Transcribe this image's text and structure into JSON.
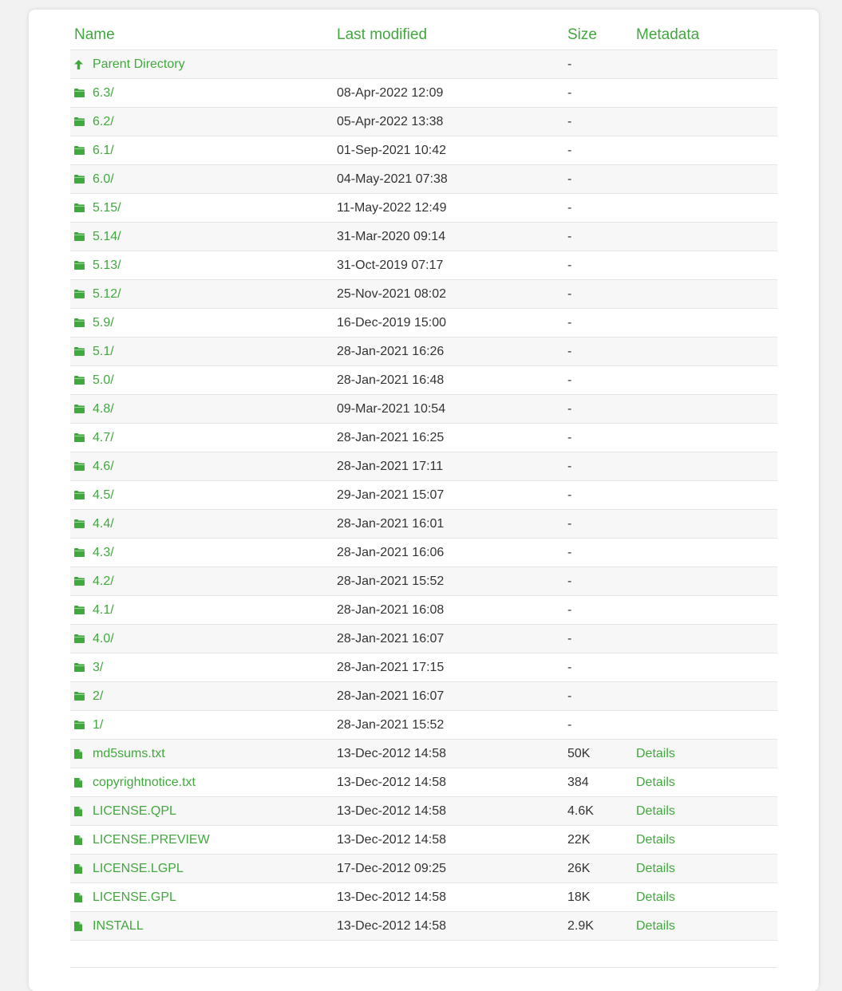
{
  "colors": {
    "accent": "#41a83e",
    "text": "#333333",
    "stripe": "#f7f7f7"
  },
  "columns": {
    "name": "Name",
    "last_modified": "Last modified",
    "size": "Size",
    "metadata": "Metadata"
  },
  "rows": [
    {
      "type": "parent",
      "icon": "arrow-up-icon",
      "name": "Parent Directory",
      "modified": "",
      "size": "-",
      "meta": ""
    },
    {
      "type": "dir",
      "icon": "folder-icon",
      "name": "6.3/",
      "modified": "08-Apr-2022 12:09",
      "size": "-",
      "meta": ""
    },
    {
      "type": "dir",
      "icon": "folder-icon",
      "name": "6.2/",
      "modified": "05-Apr-2022 13:38",
      "size": "-",
      "meta": ""
    },
    {
      "type": "dir",
      "icon": "folder-icon",
      "name": "6.1/",
      "modified": "01-Sep-2021 10:42",
      "size": "-",
      "meta": ""
    },
    {
      "type": "dir",
      "icon": "folder-icon",
      "name": "6.0/",
      "modified": "04-May-2021 07:38",
      "size": "-",
      "meta": ""
    },
    {
      "type": "dir",
      "icon": "folder-icon",
      "name": "5.15/",
      "modified": "11-May-2022 12:49",
      "size": "-",
      "meta": ""
    },
    {
      "type": "dir",
      "icon": "folder-icon",
      "name": "5.14/",
      "modified": "31-Mar-2020 09:14",
      "size": "-",
      "meta": ""
    },
    {
      "type": "dir",
      "icon": "folder-icon",
      "name": "5.13/",
      "modified": "31-Oct-2019 07:17",
      "size": "-",
      "meta": ""
    },
    {
      "type": "dir",
      "icon": "folder-icon",
      "name": "5.12/",
      "modified": "25-Nov-2021 08:02",
      "size": "-",
      "meta": ""
    },
    {
      "type": "dir",
      "icon": "folder-icon",
      "name": "5.9/",
      "modified": "16-Dec-2019 15:00",
      "size": "-",
      "meta": ""
    },
    {
      "type": "dir",
      "icon": "folder-icon",
      "name": "5.1/",
      "modified": "28-Jan-2021 16:26",
      "size": "-",
      "meta": ""
    },
    {
      "type": "dir",
      "icon": "folder-icon",
      "name": "5.0/",
      "modified": "28-Jan-2021 16:48",
      "size": "-",
      "meta": ""
    },
    {
      "type": "dir",
      "icon": "folder-icon",
      "name": "4.8/",
      "modified": "09-Mar-2021 10:54",
      "size": "-",
      "meta": ""
    },
    {
      "type": "dir",
      "icon": "folder-icon",
      "name": "4.7/",
      "modified": "28-Jan-2021 16:25",
      "size": "-",
      "meta": ""
    },
    {
      "type": "dir",
      "icon": "folder-icon",
      "name": "4.6/",
      "modified": "28-Jan-2021 17:11",
      "size": "-",
      "meta": ""
    },
    {
      "type": "dir",
      "icon": "folder-icon",
      "name": "4.5/",
      "modified": "29-Jan-2021 15:07",
      "size": "-",
      "meta": ""
    },
    {
      "type": "dir",
      "icon": "folder-icon",
      "name": "4.4/",
      "modified": "28-Jan-2021 16:01",
      "size": "-",
      "meta": ""
    },
    {
      "type": "dir",
      "icon": "folder-icon",
      "name": "4.3/",
      "modified": "28-Jan-2021 16:06",
      "size": "-",
      "meta": ""
    },
    {
      "type": "dir",
      "icon": "folder-icon",
      "name": "4.2/",
      "modified": "28-Jan-2021 15:52",
      "size": "-",
      "meta": ""
    },
    {
      "type": "dir",
      "icon": "folder-icon",
      "name": "4.1/",
      "modified": "28-Jan-2021 16:08",
      "size": "-",
      "meta": ""
    },
    {
      "type": "dir",
      "icon": "folder-icon",
      "name": "4.0/",
      "modified": "28-Jan-2021 16:07",
      "size": "-",
      "meta": ""
    },
    {
      "type": "dir",
      "icon": "folder-icon",
      "name": "3/",
      "modified": "28-Jan-2021 17:15",
      "size": "-",
      "meta": ""
    },
    {
      "type": "dir",
      "icon": "folder-icon",
      "name": "2/",
      "modified": "28-Jan-2021 16:07",
      "size": "-",
      "meta": ""
    },
    {
      "type": "dir",
      "icon": "folder-icon",
      "name": "1/",
      "modified": "28-Jan-2021 15:52",
      "size": "-",
      "meta": ""
    },
    {
      "type": "file",
      "icon": "file-icon",
      "name": "md5sums.txt",
      "modified": "13-Dec-2012 14:58",
      "size": "50K",
      "meta": "Details"
    },
    {
      "type": "file",
      "icon": "file-icon",
      "name": "copyrightnotice.txt",
      "modified": "13-Dec-2012 14:58",
      "size": "384",
      "meta": "Details"
    },
    {
      "type": "file",
      "icon": "file-icon",
      "name": "LICENSE.QPL",
      "modified": "13-Dec-2012 14:58",
      "size": "4.6K",
      "meta": "Details"
    },
    {
      "type": "file",
      "icon": "file-icon",
      "name": "LICENSE.PREVIEW",
      "modified": "13-Dec-2012 14:58",
      "size": "22K",
      "meta": "Details"
    },
    {
      "type": "file",
      "icon": "file-icon",
      "name": "LICENSE.LGPL",
      "modified": "17-Dec-2012 09:25",
      "size": "26K",
      "meta": "Details"
    },
    {
      "type": "file",
      "icon": "file-icon",
      "name": "LICENSE.GPL",
      "modified": "13-Dec-2012 14:58",
      "size": "18K",
      "meta": "Details"
    },
    {
      "type": "file",
      "icon": "file-icon",
      "name": "INSTALL",
      "modified": "13-Dec-2012 14:58",
      "size": "2.9K",
      "meta": "Details"
    }
  ]
}
